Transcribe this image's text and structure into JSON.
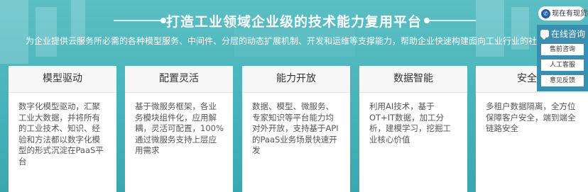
{
  "header": {
    "title": "打造工业领域企业级的技术能力复用平台",
    "subtitle": "为企业提供云服务所必需的各种模型服务、中间件、分层的动态扩展机制、开发和运维等支撑能力，帮助企业快速构建面向工业行业的社会级服"
  },
  "cards": [
    {
      "title": "模型驱动",
      "body": "数字化模型驱动，汇聚工业大数据，并将所有的工业技术、知识、经验和方法都以数字化模型的形式沉淀在PaaS平台"
    },
    {
      "title": "配置灵活",
      "body": "基于微服务框架，各业务模块组件化，应用解耦，灵活可配置，100%通过微服务支持上层应用需求"
    },
    {
      "title": "能力开放",
      "body": "数据、模型、微服务、专家知识等平台能力均对外开放，支持基于API 的PaaS业务场景快速开发"
    },
    {
      "title": "数据智能",
      "body": "利用AI技术，基于OT+IT数据，加工分析，建模学习，挖掘工业核心价值"
    },
    {
      "title": "安全可",
      "body": "多租户数据隔离，全方位保障客户安全，端到端全链路安全"
    }
  ],
  "contact": {
    "phone_label": "现在有现货吗",
    "consult_title": "在线咨询",
    "items": [
      "售前咨询",
      "人工客服",
      "意见反馈"
    ]
  },
  "icons": {
    "phone": "phone-icon",
    "chat": "chat-icon",
    "scroll_top": "arrow-up-icon"
  }
}
